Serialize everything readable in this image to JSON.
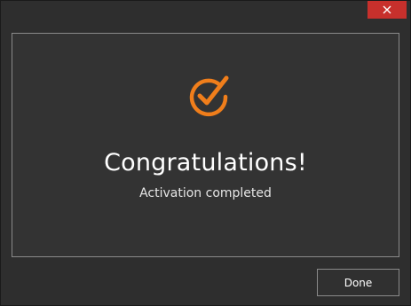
{
  "titlebar": {
    "close_icon": "close-icon"
  },
  "content": {
    "icon": "checkmark-circle-icon",
    "heading": "Congratulations!",
    "message": "Activation completed"
  },
  "footer": {
    "done_label": "Done"
  },
  "colors": {
    "accent": "#f07e1b",
    "close_button": "#c7302c",
    "background": "#2e2e2e",
    "panel": "#333333"
  }
}
